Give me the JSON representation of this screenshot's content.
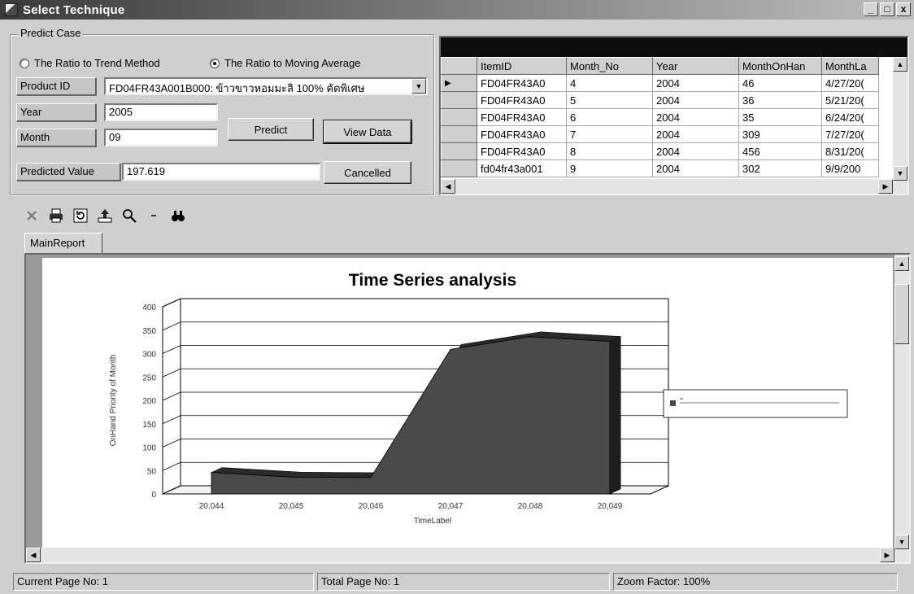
{
  "window": {
    "title": "Select Technique",
    "controls": [
      "_",
      "□",
      "x"
    ]
  },
  "predict_case": {
    "legend": "Predict Case",
    "methods": [
      {
        "label": "The Ratio to Trend Method",
        "selected": false
      },
      {
        "label": "The Ratio to Moving Average",
        "selected": true
      }
    ],
    "product_id_label": "Product ID",
    "product_id_value": "FD04FR43A001B000: ข้าวขาวหอมมะลิ 100% คัดพิเศษ",
    "year_label": "Year",
    "year_value": "2005",
    "month_label": "Month",
    "month_value": "09",
    "predicted_label": "Predicted Value",
    "predicted_value": "197.619",
    "predict_button": "Predict",
    "view_data_button": "View Data",
    "cancel_button": "Cancelled"
  },
  "grid": {
    "columns": [
      "ItemID",
      "Month_No",
      "Year",
      "MonthOnHan",
      "MonthLa"
    ],
    "rows": [
      [
        "FD04FR43A0",
        "4",
        "2004",
        "46",
        "4/27/20("
      ],
      [
        "FD04FR43A0",
        "5",
        "2004",
        "36",
        "5/21/20("
      ],
      [
        "FD04FR43A0",
        "6",
        "2004",
        "35",
        "6/24/20("
      ],
      [
        "FD04FR43A0",
        "7",
        "2004",
        "309",
        "7/27/20("
      ],
      [
        "FD04FR43A0",
        "8",
        "2004",
        "456",
        "8/31/20("
      ],
      [
        "fd04fr43a001",
        "9",
        "2004",
        "302",
        "9/9/200"
      ]
    ],
    "current_row": 0
  },
  "toolbar": {
    "icons": [
      "close-icon",
      "print-icon",
      "refresh-icon",
      "export-icon",
      "zoom-icon",
      "dropdown-icon",
      "find-icon"
    ]
  },
  "report": {
    "tab_label": "MainReport"
  },
  "chart_data": {
    "type": "area",
    "title": "Time Series analysis",
    "xlabel": "TimeLabel",
    "ylabel": "OnHand Priority of Month",
    "categories": [
      "20,044",
      "20,045",
      "20,046",
      "20,047",
      "20,048",
      "20,049"
    ],
    "yticks": [
      0,
      50,
      100,
      150,
      200,
      250,
      300,
      350,
      400
    ],
    "ylim": [
      0,
      400
    ],
    "grid": true,
    "three_d": true,
    "legend_position": "right",
    "series": [
      {
        "values": [
          46,
          36,
          35,
          309,
          336,
          326
        ],
        "color": "#4a4a4a"
      }
    ]
  },
  "status": {
    "current_page": "Current Page No: 1",
    "total_page": "Total Page No: 1",
    "zoom": "Zoom Factor: 100%"
  }
}
